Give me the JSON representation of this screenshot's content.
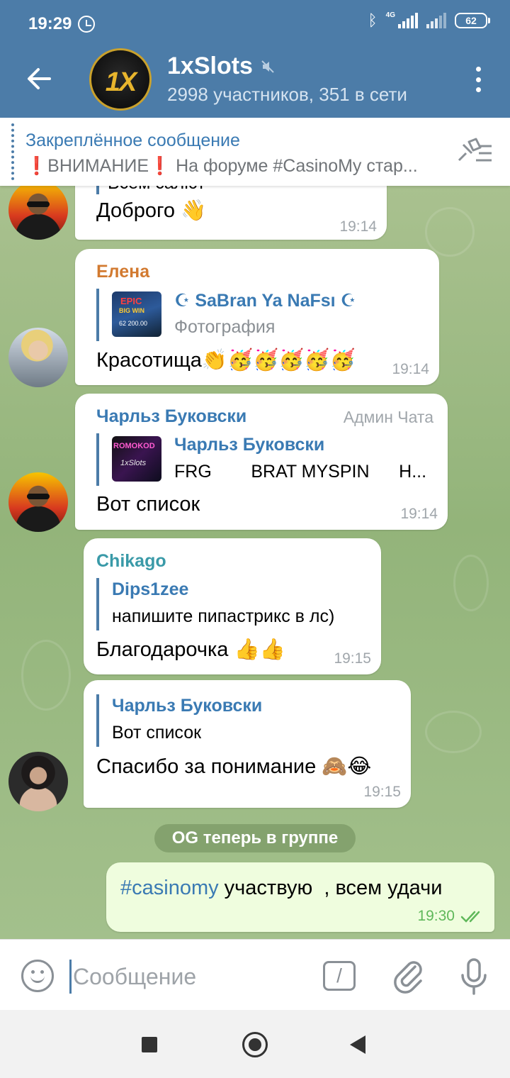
{
  "status_bar": {
    "time": "19:29",
    "network": "4G",
    "battery": "62",
    "icons": [
      "alarm-icon",
      "bluetooth-icon",
      "signal-icon",
      "battery-icon"
    ]
  },
  "header": {
    "title": "1xSlots",
    "subtitle": "2998 участников, 351 в сети",
    "avatar_logo": "1X",
    "muted": true
  },
  "pinned": {
    "title": "Закреплённое сообщение",
    "text_prefix": "❗",
    "text_main": "ВНИМАНИЕ",
    "text_suffix": "❗ На форуме #CasinoMy стар..."
  },
  "messages": [
    {
      "partial_quote": "Всем салют",
      "text": "Доброго 👋",
      "time": "19:14"
    },
    {
      "sender": "Елена",
      "sender_color": "#d27a30",
      "quote_name": "☪ SaBran Ya NaFsı ☪",
      "quote_sub": "Фотография",
      "thumb_text_1": "EPIC",
      "thumb_text_2": "BIG WIN",
      "thumb_text_3": "62 200.00",
      "text": "Красотища👏🥳🥳🥳🥳🥳",
      "time": "19:14"
    },
    {
      "sender": "Чарльз Буковски",
      "sender_color": "#3a7ab3",
      "admin_tag": "Админ Чата",
      "quote_name": "Чарльз Буковски",
      "quote_text": "FRG        BRAT MYSPIN      H...",
      "thumb_text_1": "ROMOKOD",
      "thumb_text_2": "1xSlots",
      "text": "Вот список",
      "time": "19:14"
    },
    {
      "sender": "Chikago",
      "sender_color": "#3a9aa8",
      "quote_name": "Dips1zee",
      "quote_text": "напишите пипастрикс в лс)",
      "text": "Благодарочка 👍👍",
      "time": "19:15"
    },
    {
      "quote_name": "Чарльз Буковски",
      "quote_text": "Вот список",
      "text": "Спасибо за понимание 🙈😂",
      "time": "19:15"
    }
  ],
  "service_message": "OG теперь в группе",
  "outgoing": {
    "hashtag": "#casinomy",
    "text": " участвую  , всем удачи",
    "time": "19:30"
  },
  "input": {
    "placeholder": "Сообщение",
    "command_label": "/"
  },
  "colors": {
    "header": "#4c7ca8",
    "accent": "#3a7ab3",
    "outgoing_bubble": "#effdde",
    "read_ticks": "#5fb85a"
  }
}
